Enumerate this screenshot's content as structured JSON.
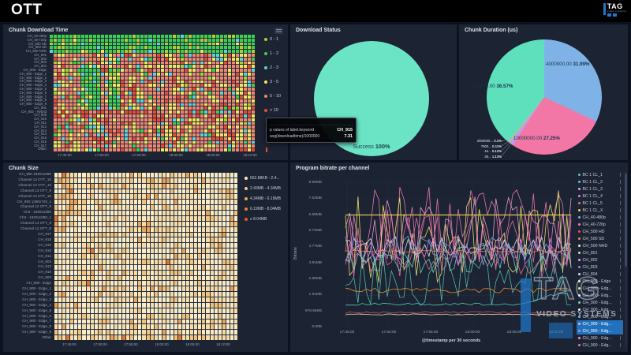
{
  "header": {
    "title": "OTT",
    "logo": {
      "brand": "TAG",
      "sub": "video systems"
    }
  },
  "watermark": {
    "brand": "TAG",
    "sub": "VIDEO SYSTEMS"
  },
  "tooltip": {
    "row1_label": "p values of label.keyword",
    "row1_value": "CH_915",
    "row2_label": "avg(downloadtime)/1000000",
    "row2_value": "7.31"
  },
  "chart_data": [
    {
      "id": "chunk_download_time",
      "dom_prefix": "hm1",
      "type": "heatmap",
      "title": "Chunk Download Time",
      "unit": "seconds",
      "rows": [
        "CH_40-480p",
        "CH_40-720p",
        "CH_500 HD",
        "CH_500 SD",
        "CH_500 NHD",
        "CH_801",
        "CH_802",
        "CH_803",
        "CH_804",
        "CH_900 - Edge",
        "CH_900 - Edge_1",
        "CH_900 - Edge_2",
        "CH_900 - Edge_3",
        "CH_900 - Edge_4",
        "CH_900 - Edge_5",
        "CH_900 - Edge_6",
        "CH_900 - Edge_7",
        "CH_900 - Edge_8",
        "CH_900 - Edge_9",
        "CH_901",
        "CH_902 - Hybrid",
        "CH_905",
        "CH_910",
        "CH_911",
        "CH_912",
        "CH_913",
        "CH_914",
        "CH_915",
        "CH_916",
        "CH_917",
        "Other"
      ],
      "x_ticks": [
        "17:45:00",
        "17:50:00",
        "17:55:00",
        "18:00:00",
        "18:05:00",
        "18:10:00"
      ],
      "tick_x0": 78,
      "tick_dx": 47,
      "legend": [
        {
          "label": "0 - 1",
          "color": "#a8d432"
        },
        {
          "label": "1 - 2",
          "color": "#3ecf4e"
        },
        {
          "label": "2 - 3",
          "color": "#5fd3d8"
        },
        {
          "label": "3 - 5",
          "color": "#f2e45c"
        },
        {
          "label": "5 - 10",
          "color": "#f0876c"
        },
        {
          "label": "> 10",
          "color": "#e84a33"
        }
      ],
      "cols": 52,
      "seed": 11,
      "empty_first_col_from": 5,
      "palette": [
        "#a8d432",
        "#3ecf4e",
        "#5fd3d8",
        "#f2e45c",
        "#f0876c",
        "#e84a33"
      ],
      "row_bands": [
        {
          "from": 0,
          "to": 4,
          "weights": [
            0.15,
            0.78,
            0.05,
            0.02,
            0,
            0
          ]
        },
        {
          "from": 5,
          "to": 30,
          "weights": [
            0.02,
            0.04,
            0.07,
            0.22,
            0.55,
            0.1
          ]
        }
      ],
      "patches": [
        {
          "r0": 9,
          "r1": 19,
          "c0": 8,
          "c1": 12,
          "weights": [
            0.12,
            0.62,
            0.1,
            0.16,
            0,
            0
          ]
        },
        {
          "r0": 9,
          "r1": 19,
          "c0": 15,
          "c1": 17,
          "weights": [
            0.12,
            0.62,
            0.1,
            0.16,
            0,
            0
          ]
        },
        {
          "r0": 20,
          "r1": 21,
          "c0": 1,
          "c1": 51,
          "weights": [
            0,
            0.02,
            0.05,
            0.13,
            0.45,
            0.35
          ]
        }
      ]
    },
    {
      "id": "download_status",
      "type": "pie",
      "title": "Download Status",
      "slices": [
        {
          "label": "Success",
          "pct": 100,
          "pct_label": "100%",
          "color": "#6be4c6"
        }
      ]
    },
    {
      "id": "chunk_duration",
      "type": "pie",
      "title": "Chunk Duration (us)",
      "slices": [
        {
          "label": "4000000.00",
          "pct": 31.99,
          "pct_label": "31.99%",
          "color": "#7fb3e8"
        },
        {
          "label": "10000000.00",
          "pct": 27.25,
          "pct_label": "27.25%",
          "color": "#f277a7"
        },
        {
          "label": "38...",
          "pct": 1.13,
          "pct_label": "1.13%",
          "color": "#b9a0e8"
        },
        {
          "label": "16...",
          "pct": 0.12,
          "pct_label": "0.12%",
          "color": "#e2b07e"
        },
        {
          "label": "7900...",
          "pct": 0.11,
          "pct_label": "0.11%",
          "color": "#d8c08a"
        },
        {
          "label": "2000000...",
          "pct": 0.1,
          "pct_label": "0.1%",
          "color": "#eda45f"
        },
        {
          "label": "7800000.00",
          "pct": 36.57,
          "pct_label": "36.57%",
          "color": "#5fe0bd"
        }
      ]
    },
    {
      "id": "chunk_size",
      "dom_prefix": "hm2",
      "type": "heatmap",
      "title": "Chunk Size",
      "rows": [
        "CH_950 1920x1080",
        "Channel 13 OTT_10",
        "Channel 12 OTT_10",
        "Channel 13 OTT_9",
        "Channel 14 OTT_10",
        "CH_950 1280x720_1",
        "Channel 12 OTT_9",
        "Ch3 - 1920x1080",
        "Ch3 - 1920x1080_1",
        "Channel 14 OTT_9",
        "Channel 13 OTT_8",
        "CH_917",
        "CH_918",
        "CH_915",
        "CH_916",
        "CH_914",
        "CH_804",
        "CH_913",
        "CH_910",
        "CH_900",
        "CH_900 - Edge",
        "CH_900 - Edge_1",
        "CH_900 - Edge_2",
        "CH_900 - Edge_3",
        "CH_900 - Edge_4",
        "CH_900 - Edge_5",
        "CH_900 - Edge_6",
        "CH_900 - Edge_7",
        "CH_900 - Edge_8",
        "CH_900 - Edge_9",
        "Other"
      ],
      "x_ticks": [
        "17:45:00",
        "17:50:00",
        "17:55:00",
        "18:00:00",
        "18:05:00",
        "18:10:00"
      ],
      "tick_x0": 84,
      "tick_dx": 39,
      "legend": [
        {
          "label": "652.88KB - 2.4...",
          "color": "#f7e9b7"
        },
        {
          "label": "2.49MB - 4.34MB",
          "color": "#f5c87a"
        },
        {
          "label": "4.34MB - 6.19MB",
          "color": "#efa94e"
        },
        {
          "label": "6.19MB - 8.04MB",
          "color": "#e8822e"
        },
        {
          "label": "≥ 8.04MB",
          "color": "#e35926"
        }
      ],
      "cols": 46,
      "seed": 7,
      "palette": [
        "#f8ecc6",
        "#f6dca4",
        "#f2c178",
        "#eda152",
        "#e2762f"
      ],
      "row_bands": [
        {
          "from": 0,
          "to": 30,
          "weights": [
            0.5,
            0.34,
            0.12,
            0.035,
            0.005
          ]
        }
      ],
      "patches": [
        {
          "r0": 0,
          "r1": 10,
          "c0": 0,
          "c1": 5,
          "weights": [
            0.2,
            0.35,
            0.3,
            0.12,
            0.03
          ]
        },
        {
          "r0": 30,
          "r1": 30,
          "c0": 0,
          "c1": 45,
          "weights": [
            0.2,
            0.4,
            0.25,
            0.12,
            0.03
          ]
        }
      ]
    },
    {
      "id": "program_bitrate",
      "type": "line",
      "title": "Program bitrate per channel",
      "ylabel": "Bitrate",
      "xlabel": "@timestamp per 30 seconds",
      "y_ticks": [
        "0.00B",
        "976.56KB",
        "1.91MB",
        "2.86MB",
        "3.81MB",
        "4.77MB",
        "5.72MB",
        "6.68MB",
        "7.63MB",
        "8.58MB"
      ],
      "x_ticks": [
        "17:45:00",
        "17:50:00",
        "17:55:00",
        "18:00:00",
        "18:05:00",
        "18:10:00"
      ],
      "ymax_mb": 9.06,
      "points": 55,
      "seed": 23,
      "grid": true,
      "legend_position": "right",
      "legend": [
        {
          "label": "BC 1 CL_1",
          "color": "#56c2b1",
          "highlight": false
        },
        {
          "label": "BC 1 CL_2",
          "color": "#4fc3f7",
          "highlight": false
        },
        {
          "label": "BC 1 CL_3",
          "color": "#e0a8d8",
          "highlight": false
        },
        {
          "label": "BC 1 CL_4",
          "color": "#c58af9",
          "highlight": false
        },
        {
          "label": "BC 1 CL_5",
          "color": "#ef6d9b",
          "highlight": false
        },
        {
          "label": "BC 1 CL_X",
          "color": "#f5d14b",
          "highlight": false
        },
        {
          "label": "CH_40-480p",
          "color": "#7eb2f2",
          "highlight": false
        },
        {
          "label": "CH_40-720p",
          "color": "#f27eb5",
          "highlight": false
        },
        {
          "label": "CH_500 HD",
          "color": "#e8535f",
          "highlight": false
        },
        {
          "label": "CH_500 SD",
          "color": "#f5855a",
          "highlight": false
        },
        {
          "label": "CH_500 NHD",
          "color": "#f7f0b0",
          "highlight": false
        },
        {
          "label": "CH_801",
          "color": "#bfe8c8",
          "highlight": false
        },
        {
          "label": "CH_802",
          "color": "#f2a4d8",
          "highlight": false
        },
        {
          "label": "CH_803",
          "color": "#9b8aef",
          "highlight": false
        },
        {
          "label": "CH_804",
          "color": "#d8dce8",
          "highlight": false
        },
        {
          "label": "CH_900 - Edge",
          "color": "#fff3a0",
          "highlight": false
        },
        {
          "label": "CH_900 - Edg...",
          "color": "#f7e96e",
          "highlight": false
        },
        {
          "label": "CH_900 - Edg...",
          "color": "#e8eef2",
          "highlight": false
        },
        {
          "label": "CH_900 - Edg...",
          "color": "#6fd8c8",
          "highlight": false
        },
        {
          "label": "CH_900 - Edg...",
          "color": "#f2f2f2",
          "highlight": false
        },
        {
          "label": "CH_900 - Edg...",
          "color": "#5bc8f2",
          "highlight": false
        },
        {
          "label": "CH_900 - Edg...",
          "color": "#f29ec8",
          "highlight": true
        },
        {
          "label": "CH_900 - Edg...",
          "color": "#b48aef",
          "highlight": true
        },
        {
          "label": "CH_900 - Edg...",
          "color": "#ef9ebc",
          "highlight": false
        },
        {
          "label": "CH_900 - Edg...",
          "color": "#f075a8",
          "highlight": false
        }
      ],
      "series": [
        {
          "name": "CH_40-720p",
          "color": "#f27eb5",
          "kind": "random",
          "min": 3.6,
          "max": 8.4
        },
        {
          "name": "CH_802",
          "color": "#f2a4d8",
          "kind": "random",
          "min": 3.8,
          "max": 7.8
        },
        {
          "name": "BC 1 CL_X",
          "color": "#f7e96e",
          "kind": "random",
          "min": 2.6,
          "max": 8.2
        },
        {
          "name": "CH_804",
          "color": "#e8eef2",
          "kind": "random",
          "min": 4.2,
          "max": 5.4
        },
        {
          "name": "CH_40-480p",
          "color": "#7eb2f2",
          "kind": "random",
          "min": 4.0,
          "max": 5.5
        },
        {
          "name": "BC 1 CL_4",
          "color": "#c58af9",
          "kind": "random",
          "min": 3.6,
          "max": 5.4
        },
        {
          "name": "BC 1 CL_5",
          "color": "#ef6d9b",
          "kind": "random",
          "min": 3.1,
          "max": 5.0
        },
        {
          "name": "CH_900 - Edge",
          "color": "#f075a8",
          "kind": "random",
          "min": 2.9,
          "max": 6.8
        },
        {
          "name": "BC 1 CL_1",
          "color": "#56c2b1",
          "kind": "random",
          "min": 1.3,
          "max": 4.4
        },
        {
          "name": "BC 1 CL_2",
          "color": "#6fd8c8",
          "kind": "random",
          "min": 3.2,
          "max": 5.0
        },
        {
          "name": "CH_801",
          "color": "#5ad8c3",
          "kind": "riser",
          "value": 1.38,
          "value2": 2.3,
          "jitter": 0.07
        },
        {
          "name": "CH_500 SD",
          "color": "#f5855a",
          "kind": "flat",
          "value": 4.52,
          "jitter": 0.07
        },
        {
          "name": "CH_500 HD",
          "color": "#ff9830",
          "kind": "flat",
          "value": 2.2,
          "jitter": 0.14
        },
        {
          "name": "CH_500 NHD",
          "color": "#f7f0b0",
          "kind": "flat",
          "value": 0.77,
          "jitter": 0.03
        },
        {
          "name": "CH_803",
          "color": "#e8535f",
          "kind": "flat",
          "value": 0.88,
          "jitter": 0.06
        },
        {
          "name": "BC 1 CL_3",
          "color": "#f5d14b",
          "kind": "flat",
          "value": 6.68,
          "jitter": 0,
          "width": 1.3
        }
      ]
    }
  ]
}
